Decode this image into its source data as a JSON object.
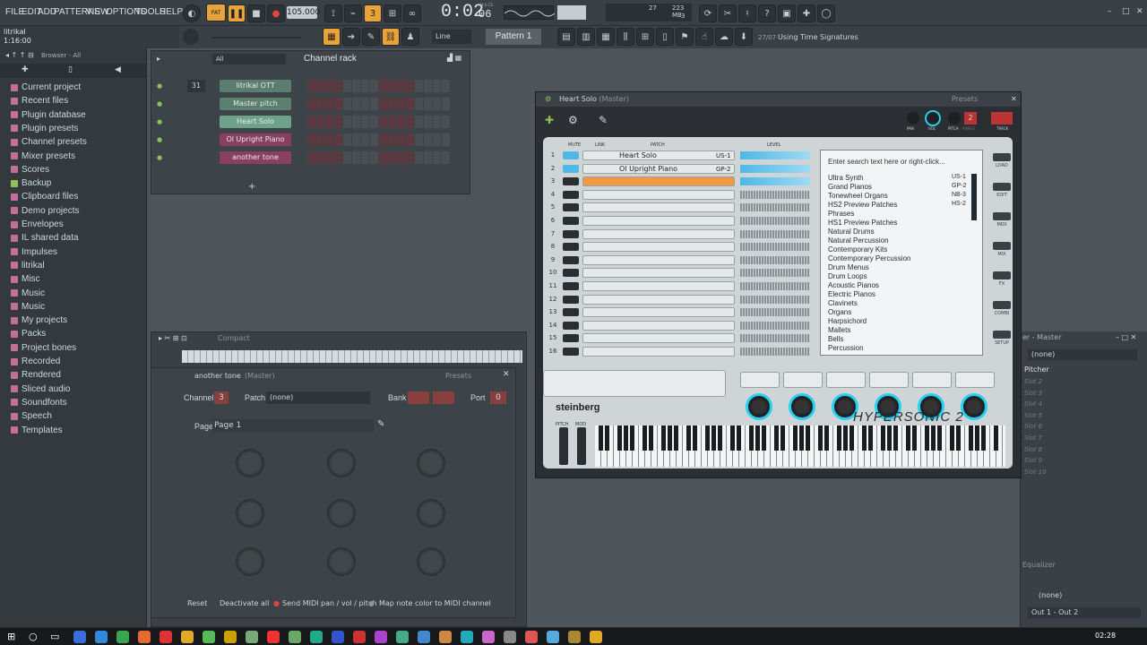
{
  "menubar": {
    "items": [
      "FILE",
      "EDIT",
      "ADD",
      "PATTERNS",
      "VIEW",
      "OPTIONS",
      "TOOLS",
      "HELP"
    ],
    "pat_song": "PAT",
    "tempo": "105.000",
    "time": "0:02",
    "time_frac": "06",
    "time_unit": "M:S:CS",
    "cpu": "27",
    "ram": "223 MB",
    "poly": "3"
  },
  "hint": {
    "line1": "litrikal",
    "line2": "1:16:00"
  },
  "toolbar2": {
    "snap": "Line",
    "pattern": "Pattern 1",
    "hint": "Using Time Signatures",
    "hint_pre": "27/07"
  },
  "browser": {
    "header": "Browser - All",
    "items": [
      {
        "label": "Current project",
        "group": "a"
      },
      {
        "label": "Recent files",
        "group": "a"
      },
      {
        "label": "Plugin database",
        "group": "a"
      },
      {
        "label": "Plugin presets",
        "group": "a"
      },
      {
        "label": "Channel presets",
        "group": "a"
      },
      {
        "label": "Mixer presets",
        "group": "a"
      },
      {
        "label": "Scores",
        "group": "a"
      },
      {
        "label": "Backup",
        "group": "g"
      },
      {
        "label": "Clipboard files",
        "group": "a"
      },
      {
        "label": "Demo projects",
        "group": "a"
      },
      {
        "label": "Envelopes",
        "group": "a"
      },
      {
        "label": "IL shared data",
        "group": "a"
      },
      {
        "label": "Impulses",
        "group": "a"
      },
      {
        "label": "litrikal",
        "group": "a"
      },
      {
        "label": "Misc",
        "group": "a"
      },
      {
        "label": "Music",
        "group": "a"
      },
      {
        "label": "Music",
        "group": "a"
      },
      {
        "label": "My projects",
        "group": "a"
      },
      {
        "label": "Packs",
        "group": "a"
      },
      {
        "label": "Project bones",
        "group": "a"
      },
      {
        "label": "Recorded",
        "group": "a"
      },
      {
        "label": "Rendered",
        "group": "a"
      },
      {
        "label": "Sliced audio",
        "group": "a"
      },
      {
        "label": "Soundfonts",
        "group": "a"
      },
      {
        "label": "Speech",
        "group": "a"
      },
      {
        "label": "Templates",
        "group": "a"
      }
    ]
  },
  "channel_rack": {
    "filter": "All",
    "title": "Channel rack",
    "swing": "31",
    "channels": [
      {
        "name": "litrikal OTT",
        "style": "n"
      },
      {
        "name": "Master pitch",
        "style": "n"
      },
      {
        "name": "Heart Solo",
        "style": "hs"
      },
      {
        "name": "Ol Upright Piano",
        "style": "op"
      },
      {
        "name": "another tone",
        "style": "op"
      }
    ]
  },
  "playlist": {
    "title": "Compact"
  },
  "pattern_window": {
    "title": "another tone",
    "title_suffix": "(Master)",
    "presets": "Presets",
    "channel_label": "Channel",
    "channel_value": "3",
    "patch_label": "Patch",
    "patch_value": "(none)",
    "bank_label": "Bank",
    "port_label": "Port",
    "port_value": "0",
    "page_label": "Page",
    "page_value": "Page 1",
    "reset": "Reset",
    "deactivate": "Deactivate all",
    "send_midi": "Send MIDI pan / vol / pitch",
    "map_color": "Map note color to MIDI channel"
  },
  "hypersonic": {
    "title": "Heart Solo",
    "title_suffix": "(Master)",
    "presets": "Presets",
    "col_mute": "MUTE",
    "col_link": "LINK",
    "col_patch": "PATCH",
    "col_level": "LEVEL",
    "knob_pan": "PAN",
    "knob_vol": "VOL",
    "knob_pitch": "PITCH",
    "knob_range": "RANGE",
    "track_label": "TRACK",
    "track_num": "2",
    "search": "Enter search text here or right-click...",
    "slots": [
      {
        "num": "1",
        "patch": "Heart Solo",
        "code": "US-1"
      },
      {
        "num": "2",
        "patch": "Ol Upright Piano",
        "code": "GP-2"
      },
      {
        "num": "3",
        "patch": "",
        "code": ""
      },
      {
        "num": "4",
        "patch": "",
        "code": ""
      },
      {
        "num": "5",
        "patch": "",
        "code": ""
      },
      {
        "num": "6",
        "patch": "",
        "code": ""
      },
      {
        "num": "7",
        "patch": "",
        "code": ""
      },
      {
        "num": "8",
        "patch": "",
        "code": ""
      },
      {
        "num": "9",
        "patch": "",
        "code": ""
      },
      {
        "num": "10",
        "patch": "",
        "code": ""
      },
      {
        "num": "11",
        "patch": "",
        "code": ""
      },
      {
        "num": "12",
        "patch": "",
        "code": ""
      },
      {
        "num": "13",
        "patch": "",
        "code": ""
      },
      {
        "num": "14",
        "patch": "",
        "code": ""
      },
      {
        "num": "15",
        "patch": "",
        "code": ""
      },
      {
        "num": "16",
        "patch": "",
        "code": ""
      }
    ],
    "categories": [
      "Ultra Synth",
      "Grand Pianos",
      "Tonewheel Organs",
      "HS2 Preview Patches",
      "Phrases",
      "HS1 Preview Patches",
      "Natural Drums",
      "Natural Percussion",
      "Contemporary Kits",
      "Contemporary Percussion",
      "Drum Menus",
      "Drum Loops",
      "Acoustic Pianos",
      "Electric Pianos",
      "Clavinets",
      "Organs",
      "Harpsichord",
      "Mallets",
      "Bells",
      "Percussion"
    ],
    "codes": [
      "US-1",
      "GP-2",
      "NB-3",
      "HS-2"
    ],
    "side_buttons": [
      "LOAD",
      "EDIT",
      "MIDI",
      "MIX",
      "FX",
      "COMBI",
      "SETUP"
    ],
    "brand": "steinberg",
    "product": "HYPERSONIC 2",
    "pitch": "PITCH",
    "mod": "MOD"
  },
  "mixer": {
    "title": "er - Master",
    "insert": "(none)",
    "slot1": "Pitcher",
    "slots": [
      "Slot 2",
      "Slot 3",
      "Slot 4",
      "Slot 5",
      "Slot 6",
      "Slot 7",
      "Slot 8",
      "Slot 9",
      "Slot 10"
    ],
    "equalizer": "Equalizer",
    "out_none": "(none)",
    "output": "Out 1 - Out 2"
  },
  "taskbar": {
    "clock": "02:28"
  }
}
